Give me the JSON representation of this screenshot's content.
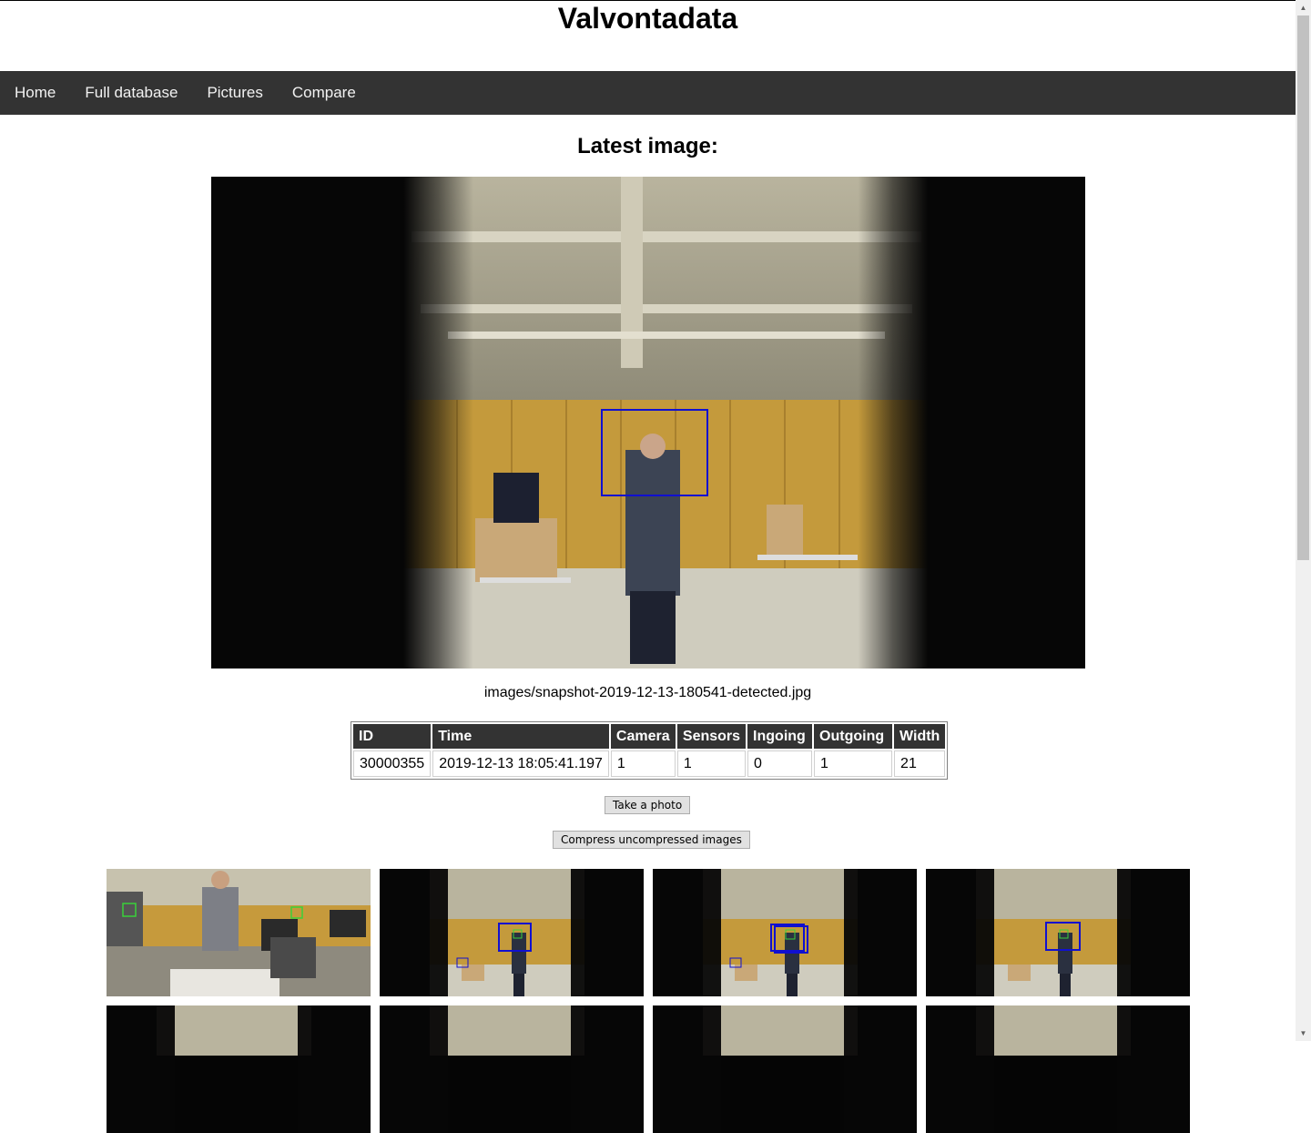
{
  "site": {
    "title": "Valvontadata"
  },
  "nav": {
    "items": [
      {
        "label": "Home"
      },
      {
        "label": "Full database"
      },
      {
        "label": "Pictures"
      },
      {
        "label": "Compare"
      }
    ]
  },
  "latest": {
    "heading": "Latest image:",
    "filename": "images/snapshot-2019-12-13-180541-detected.jpg"
  },
  "table": {
    "headers": [
      "ID",
      "Time",
      "Camera",
      "Sensors",
      "Ingoing",
      "Outgoing",
      "Width"
    ],
    "row": [
      "30000355",
      "2019-12-13 18:05:41.197",
      "1",
      "1",
      "0",
      "1",
      "21"
    ]
  },
  "buttons": {
    "take_photo": "Take a photo",
    "compress": "Compress uncompressed images"
  },
  "colors": {
    "navbar_bg": "#333333",
    "table_header_bg": "#333333",
    "detection_box": "#1010d0",
    "face_box": "#3ad13a"
  },
  "icons": {
    "scroll_up": "triangle-up-icon",
    "scroll_down": "triangle-down-icon"
  }
}
